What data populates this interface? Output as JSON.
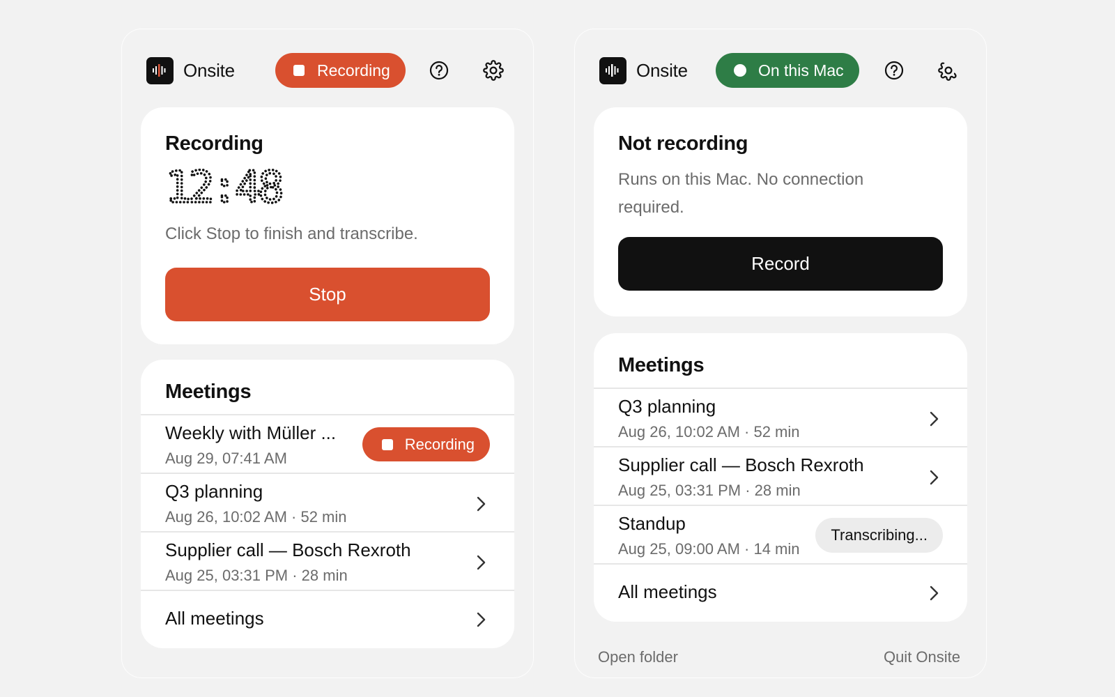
{
  "left": {
    "brand": "Onsite",
    "status_pill": "Recording",
    "recording_card": {
      "title": "Recording",
      "timer": "12:48",
      "hint": "Click Stop to finish and transcribe.",
      "button": "Stop"
    },
    "meetings": {
      "title": "Meetings",
      "items": [
        {
          "title": "Weekly with Müller ...",
          "sub": "Aug 29, 07:41 AM",
          "badge": "Recording"
        },
        {
          "title": "Q3 planning",
          "sub": "Aug 26, 10:02 AM · 52 min"
        },
        {
          "title": "Supplier call — Bosch Rexroth",
          "sub": "Aug 25, 03:31 PM · 28 min"
        }
      ],
      "all_label": "All meetings"
    }
  },
  "right": {
    "brand": "Onsite",
    "status_pill": "On this Mac",
    "status_card": {
      "title": "Not recording",
      "desc_line1": "Runs on this Mac. No connection",
      "desc_line2": "required.",
      "button": "Record"
    },
    "meetings": {
      "title": "Meetings",
      "items": [
        {
          "title": "Q3 planning",
          "sub": "Aug 26, 10:02 AM · 52 min"
        },
        {
          "title": "Supplier call — Bosch Rexroth",
          "sub": "Aug 25, 03:31 PM · 28 min"
        },
        {
          "title": "Standup",
          "sub": "Aug 25, 09:00 AM · 14 min",
          "badge": "Transcribing..."
        }
      ],
      "all_label": "All meetings"
    },
    "footer": {
      "open_folder": "Open folder",
      "quit": "Quit Onsite"
    }
  },
  "colors": {
    "recording": "#d9502f",
    "on_mac": "#2e7d46",
    "record_button": "#111111"
  },
  "icons": [
    "audio-waveform-logo-icon",
    "help-circle-icon",
    "gear-icon",
    "chevron-right-icon",
    "stop-square-icon",
    "status-dot-icon"
  ]
}
